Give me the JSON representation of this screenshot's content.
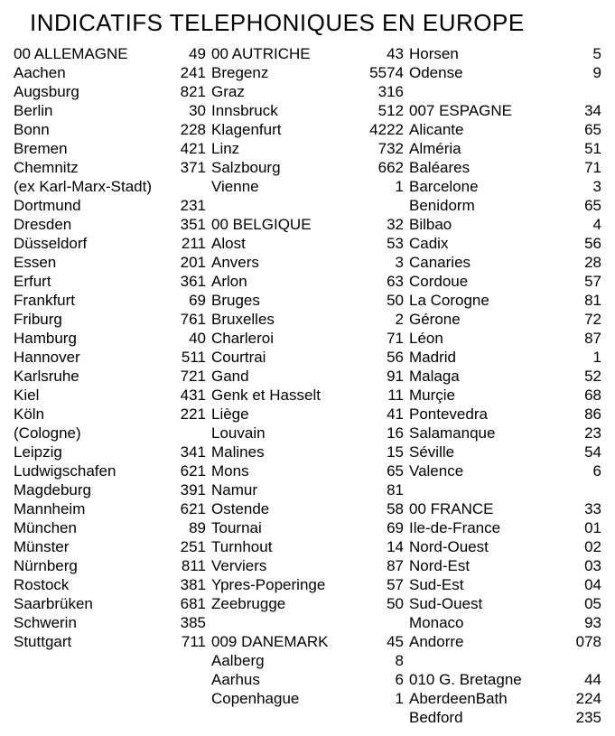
{
  "title": "INDICATIFS TELEPHONIQUES EN EUROPE",
  "columns": [
    [
      {
        "name": "00 ALLEMAGNE",
        "code": "49"
      },
      {
        "name": "Aachen",
        "code": "241"
      },
      {
        "name": "Augsburg",
        "code": "821"
      },
      {
        "name": "Berlin",
        "code": "30"
      },
      {
        "name": "Bonn",
        "code": "228"
      },
      {
        "name": "Bremen",
        "code": "421"
      },
      {
        "name": "Chemnitz",
        "code": "371"
      },
      {
        "name": "(ex Karl-Marx-Stadt)",
        "code": ""
      },
      {
        "name": "Dortmund",
        "code": "231"
      },
      {
        "name": "Dresden",
        "code": "351"
      },
      {
        "name": "Düsseldorf",
        "code": "211"
      },
      {
        "name": "Essen",
        "code": "201"
      },
      {
        "name": "Erfurt",
        "code": "361"
      },
      {
        "name": "Frankfurt",
        "code": "69"
      },
      {
        "name": "Friburg",
        "code": "761"
      },
      {
        "name": "Hamburg",
        "code": "40"
      },
      {
        "name": "Hannover",
        "code": "511"
      },
      {
        "name": "Karlsruhe",
        "code": "721"
      },
      {
        "name": "Kiel",
        "code": "431"
      },
      {
        "name": "Köln",
        "code": "221"
      },
      {
        "name": "(Cologne)",
        "code": ""
      },
      {
        "name": "Leipzig",
        "code": "341"
      },
      {
        "name": "Ludwigschafen",
        "code": "621"
      },
      {
        "name": "Magdeburg",
        "code": "391"
      },
      {
        "name": "Mannheim",
        "code": "621"
      },
      {
        "name": "München",
        "code": "89"
      },
      {
        "name": "Münster",
        "code": "251"
      },
      {
        "name": "Nürnberg",
        "code": "811"
      },
      {
        "name": "Rostock",
        "code": "381"
      },
      {
        "name": "Saarbrüken",
        "code": "681"
      },
      {
        "name": "Schwerin",
        "code": "385"
      },
      {
        "name": "Stuttgart",
        "code": "711"
      }
    ],
    [
      {
        "name": "00 AUTRICHE",
        "code": "43"
      },
      {
        "name": "Bregenz",
        "code": "5574"
      },
      {
        "name": "Graz",
        "code": "316"
      },
      {
        "name": "Innsbruck",
        "code": "512"
      },
      {
        "name": "Klagenfurt",
        "code": "4222"
      },
      {
        "name": "Linz",
        "code": "732"
      },
      {
        "name": "Salzbourg",
        "code": "662"
      },
      {
        "name": "Vienne",
        "code": "1"
      },
      {
        "spacer": true
      },
      {
        "name": "00 BELGIQUE",
        "code": "32"
      },
      {
        "name": "Alost",
        "code": "53"
      },
      {
        "name": "Anvers",
        "code": "3"
      },
      {
        "name": "Arlon",
        "code": "63"
      },
      {
        "name": "Bruges",
        "code": "50"
      },
      {
        "name": "Bruxelles",
        "code": "2"
      },
      {
        "name": "Charleroi",
        "code": "71"
      },
      {
        "name": "Courtrai",
        "code": "56"
      },
      {
        "name": "Gand",
        "code": "91"
      },
      {
        "name": "Genk et Hasselt",
        "code": "11"
      },
      {
        "name": "Liège",
        "code": "41"
      },
      {
        "name": "Louvain",
        "code": "16"
      },
      {
        "name": "Malines",
        "code": "15"
      },
      {
        "name": "Mons",
        "code": "65"
      },
      {
        "name": "Namur",
        "code": "81"
      },
      {
        "name": "Ostende",
        "code": "58"
      },
      {
        "name": "Tournai",
        "code": "69"
      },
      {
        "name": "Turnhout",
        "code": "14"
      },
      {
        "name": "Verviers",
        "code": "87"
      },
      {
        "name": "Ypres-Poperinge",
        "code": "57"
      },
      {
        "name": "Zeebrugge",
        "code": "50"
      },
      {
        "spacer": true
      },
      {
        "name": "009 DANEMARK",
        "code": "45"
      },
      {
        "name": "Aalberg",
        "code": "8"
      },
      {
        "name": "Aarhus",
        "code": "6"
      },
      {
        "name": "Copenhague",
        "code": "1"
      }
    ],
    [
      {
        "name": "Horsen",
        "code": "5"
      },
      {
        "name": "Odense",
        "code": "9"
      },
      {
        "spacer": true
      },
      {
        "name": "007 ESPAGNE",
        "code": "34"
      },
      {
        "name": "Alicante",
        "code": "65"
      },
      {
        "name": "Alméria",
        "code": "51"
      },
      {
        "name": "Baléares",
        "code": "71"
      },
      {
        "name": "Barcelone",
        "code": "3"
      },
      {
        "name": "Benidorm",
        "code": "65"
      },
      {
        "name": "Bilbao",
        "code": "4"
      },
      {
        "name": "Cadix",
        "code": "56"
      },
      {
        "name": "Canaries",
        "code": "28"
      },
      {
        "name": "Cordoue",
        "code": "57"
      },
      {
        "name": "La Corogne",
        "code": "81"
      },
      {
        "name": "Gérone",
        "code": "72"
      },
      {
        "name": "Léon",
        "code": "87"
      },
      {
        "name": "Madrid",
        "code": "1"
      },
      {
        "name": "Malaga",
        "code": "52"
      },
      {
        "name": "Murçie",
        "code": "68"
      },
      {
        "name": "Pontevedra",
        "code": "86"
      },
      {
        "name": "Salamanque",
        "code": "23"
      },
      {
        "name": "Séville",
        "code": "54"
      },
      {
        "name": "Valence",
        "code": "6"
      },
      {
        "spacer": true
      },
      {
        "name": "00 FRANCE",
        "code": "33"
      },
      {
        "name": "Ile-de-France",
        "code": "01"
      },
      {
        "name": "Nord-Ouest",
        "code": "02"
      },
      {
        "name": "Nord-Est",
        "code": "03"
      },
      {
        "name": "Sud-Est",
        "code": "04"
      },
      {
        "name": "Sud-Ouest",
        "code": "05"
      },
      {
        "name": "Monaco",
        "code": "93"
      },
      {
        "name": "Andorre",
        "code": "078"
      },
      {
        "spacer": true
      },
      {
        "name": "010 G. Bretagne",
        "code": "44"
      },
      {
        "name": "AberdeenBath",
        "code": "224"
      },
      {
        "name": "Bedford",
        "code": "235"
      }
    ]
  ]
}
